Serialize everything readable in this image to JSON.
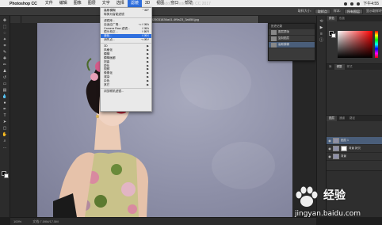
{
  "menubar": {
    "app_name": "Photoshop CC",
    "items": [
      "文件",
      "编辑",
      "图像",
      "图层",
      "文字",
      "选择",
      "滤镜",
      "3D",
      "视图",
      "窗口",
      "帮助"
    ],
    "active_item": "滤镜",
    "clock": "下午4:55"
  },
  "window_title": "Adobe Photoshop CC 2017",
  "options": {
    "sample_label": "取样大小:",
    "sample_value": "取样点",
    "sample_all_label": "样本:",
    "sample_all_value": "所有图层",
    "ring_label": "显示取样环"
  },
  "tabs": [
    "9b4a6f5f62aa77dbcbbd29447951025031836a41-4f9a23_3a658.jpg"
  ],
  "filter_menu": {
    "items_top": [
      {
        "label": "高斯模糊",
        "shortcut": "⌃⌘F"
      },
      {
        "label": "转换为智能滤镜",
        "shortcut": ""
      }
    ],
    "items_mid": [
      {
        "label": "滤镜库...",
        "shortcut": ""
      },
      {
        "label": "自适应广角...",
        "shortcut": "⌥⇧⌘A"
      },
      {
        "label": "Camera Raw 滤镜...",
        "shortcut": "⇧⌘A"
      },
      {
        "label": "镜头校正...",
        "shortcut": "⇧⌘R"
      },
      {
        "label": "液化...",
        "shortcut": "⇧⌘X",
        "highlight": true
      },
      {
        "label": "消失点...",
        "shortcut": "⌥⌘V"
      }
    ],
    "items_sub": [
      {
        "label": "3D",
        "submenu": true
      },
      {
        "label": "风格化",
        "submenu": true
      },
      {
        "label": "模糊",
        "submenu": true
      },
      {
        "label": "模糊画廊",
        "submenu": true
      },
      {
        "label": "扭曲",
        "submenu": true
      },
      {
        "label": "锐化",
        "submenu": true
      },
      {
        "label": "视频",
        "submenu": true
      },
      {
        "label": "像素化",
        "submenu": true
      },
      {
        "label": "渲染",
        "submenu": true
      },
      {
        "label": "杂色",
        "submenu": true
      },
      {
        "label": "其它",
        "submenu": true
      }
    ],
    "items_bottom": [
      {
        "label": "浏览联机滤镜...",
        "shortcut": ""
      }
    ]
  },
  "history_panel": {
    "title": "历史记录",
    "rows": [
      "图层蒙版",
      "复制图层",
      "高斯模糊"
    ],
    "selected_index": 2
  },
  "right_panel": {
    "tabs": [
      "颜色",
      "色板"
    ],
    "adjust_tabs": [
      "库",
      "调整",
      "样式"
    ],
    "layers_tabs": [
      "图层",
      "通道",
      "路径"
    ]
  },
  "layers": [
    {
      "name": "图层 1",
      "visible": true,
      "mask": false,
      "selected": true
    },
    {
      "name": "背景 拷贝",
      "visible": true,
      "mask": true,
      "selected": false
    },
    {
      "name": "背景",
      "visible": true,
      "mask": false,
      "selected": false
    }
  ],
  "statusbar": {
    "zoom": "100%",
    "doc": "文档:7.59M/17.5M"
  },
  "watermark": {
    "brand": "Bai",
    "brand_cn": "经验",
    "url": "jingyan.baidu.com"
  },
  "colors": {
    "accent": "#2f6fde",
    "canvas_bg": "#8e90a8",
    "ui_dark": "#2c2c2c"
  }
}
